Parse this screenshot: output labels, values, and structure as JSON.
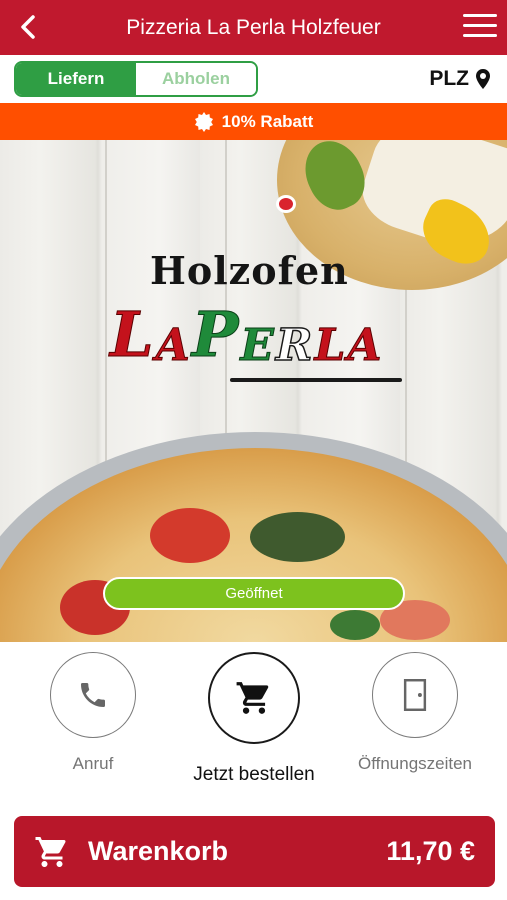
{
  "header": {
    "title": "Pizzeria La Perla Holzfeuer"
  },
  "order_mode": {
    "options": [
      {
        "label": "Liefern",
        "selected": true
      },
      {
        "label": "Abholen",
        "selected": false
      }
    ],
    "postal_code_label": "PLZ"
  },
  "discount": {
    "text": "10% Rabatt"
  },
  "hero": {
    "logo_top": "Holzofen",
    "logo_letters": [
      "L",
      "A",
      "P",
      "E",
      "R",
      "L",
      "A"
    ],
    "status": "Geöffnet"
  },
  "actions": [
    {
      "label": "Anruf",
      "icon": "phone-icon"
    },
    {
      "label": "Jetzt bestellen",
      "icon": "cart-icon"
    },
    {
      "label": "Öffnungszeiten",
      "icon": "door-icon"
    }
  ],
  "cart": {
    "label": "Warenkorb",
    "total": "11,70 €"
  },
  "colors": {
    "brand_red": "#c0192e",
    "green": "#2f9e44",
    "discount_orange": "#ff4f00",
    "open_green": "#7dc21e"
  }
}
